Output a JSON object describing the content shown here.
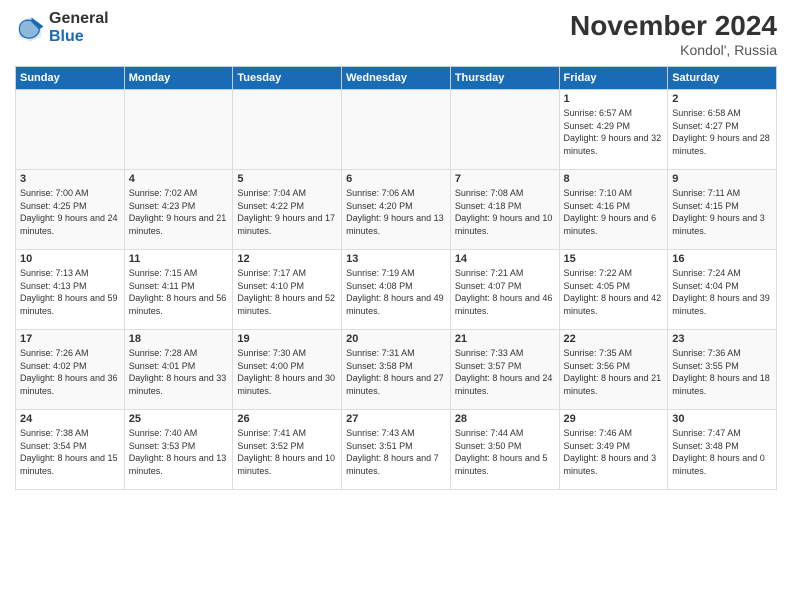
{
  "logo": {
    "general": "General",
    "blue": "Blue"
  },
  "title": "November 2024",
  "location": "Kondol', Russia",
  "days_of_week": [
    "Sunday",
    "Monday",
    "Tuesday",
    "Wednesday",
    "Thursday",
    "Friday",
    "Saturday"
  ],
  "weeks": [
    [
      {
        "day": "",
        "info": ""
      },
      {
        "day": "",
        "info": ""
      },
      {
        "day": "",
        "info": ""
      },
      {
        "day": "",
        "info": ""
      },
      {
        "day": "",
        "info": ""
      },
      {
        "day": "1",
        "info": "Sunrise: 6:57 AM\nSunset: 4:29 PM\nDaylight: 9 hours\nand 32 minutes."
      },
      {
        "day": "2",
        "info": "Sunrise: 6:58 AM\nSunset: 4:27 PM\nDaylight: 9 hours\nand 28 minutes."
      }
    ],
    [
      {
        "day": "3",
        "info": "Sunrise: 7:00 AM\nSunset: 4:25 PM\nDaylight: 9 hours\nand 24 minutes."
      },
      {
        "day": "4",
        "info": "Sunrise: 7:02 AM\nSunset: 4:23 PM\nDaylight: 9 hours\nand 21 minutes."
      },
      {
        "day": "5",
        "info": "Sunrise: 7:04 AM\nSunset: 4:22 PM\nDaylight: 9 hours\nand 17 minutes."
      },
      {
        "day": "6",
        "info": "Sunrise: 7:06 AM\nSunset: 4:20 PM\nDaylight: 9 hours\nand 13 minutes."
      },
      {
        "day": "7",
        "info": "Sunrise: 7:08 AM\nSunset: 4:18 PM\nDaylight: 9 hours\nand 10 minutes."
      },
      {
        "day": "8",
        "info": "Sunrise: 7:10 AM\nSunset: 4:16 PM\nDaylight: 9 hours\nand 6 minutes."
      },
      {
        "day": "9",
        "info": "Sunrise: 7:11 AM\nSunset: 4:15 PM\nDaylight: 9 hours\nand 3 minutes."
      }
    ],
    [
      {
        "day": "10",
        "info": "Sunrise: 7:13 AM\nSunset: 4:13 PM\nDaylight: 8 hours\nand 59 minutes."
      },
      {
        "day": "11",
        "info": "Sunrise: 7:15 AM\nSunset: 4:11 PM\nDaylight: 8 hours\nand 56 minutes."
      },
      {
        "day": "12",
        "info": "Sunrise: 7:17 AM\nSunset: 4:10 PM\nDaylight: 8 hours\nand 52 minutes."
      },
      {
        "day": "13",
        "info": "Sunrise: 7:19 AM\nSunset: 4:08 PM\nDaylight: 8 hours\nand 49 minutes."
      },
      {
        "day": "14",
        "info": "Sunrise: 7:21 AM\nSunset: 4:07 PM\nDaylight: 8 hours\nand 46 minutes."
      },
      {
        "day": "15",
        "info": "Sunrise: 7:22 AM\nSunset: 4:05 PM\nDaylight: 8 hours\nand 42 minutes."
      },
      {
        "day": "16",
        "info": "Sunrise: 7:24 AM\nSunset: 4:04 PM\nDaylight: 8 hours\nand 39 minutes."
      }
    ],
    [
      {
        "day": "17",
        "info": "Sunrise: 7:26 AM\nSunset: 4:02 PM\nDaylight: 8 hours\nand 36 minutes."
      },
      {
        "day": "18",
        "info": "Sunrise: 7:28 AM\nSunset: 4:01 PM\nDaylight: 8 hours\nand 33 minutes."
      },
      {
        "day": "19",
        "info": "Sunrise: 7:30 AM\nSunset: 4:00 PM\nDaylight: 8 hours\nand 30 minutes."
      },
      {
        "day": "20",
        "info": "Sunrise: 7:31 AM\nSunset: 3:58 PM\nDaylight: 8 hours\nand 27 minutes."
      },
      {
        "day": "21",
        "info": "Sunrise: 7:33 AM\nSunset: 3:57 PM\nDaylight: 8 hours\nand 24 minutes."
      },
      {
        "day": "22",
        "info": "Sunrise: 7:35 AM\nSunset: 3:56 PM\nDaylight: 8 hours\nand 21 minutes."
      },
      {
        "day": "23",
        "info": "Sunrise: 7:36 AM\nSunset: 3:55 PM\nDaylight: 8 hours\nand 18 minutes."
      }
    ],
    [
      {
        "day": "24",
        "info": "Sunrise: 7:38 AM\nSunset: 3:54 PM\nDaylight: 8 hours\nand 15 minutes."
      },
      {
        "day": "25",
        "info": "Sunrise: 7:40 AM\nSunset: 3:53 PM\nDaylight: 8 hours\nand 13 minutes."
      },
      {
        "day": "26",
        "info": "Sunrise: 7:41 AM\nSunset: 3:52 PM\nDaylight: 8 hours\nand 10 minutes."
      },
      {
        "day": "27",
        "info": "Sunrise: 7:43 AM\nSunset: 3:51 PM\nDaylight: 8 hours\nand 7 minutes."
      },
      {
        "day": "28",
        "info": "Sunrise: 7:44 AM\nSunset: 3:50 PM\nDaylight: 8 hours\nand 5 minutes."
      },
      {
        "day": "29",
        "info": "Sunrise: 7:46 AM\nSunset: 3:49 PM\nDaylight: 8 hours\nand 3 minutes."
      },
      {
        "day": "30",
        "info": "Sunrise: 7:47 AM\nSunset: 3:48 PM\nDaylight: 8 hours\nand 0 minutes."
      }
    ]
  ]
}
